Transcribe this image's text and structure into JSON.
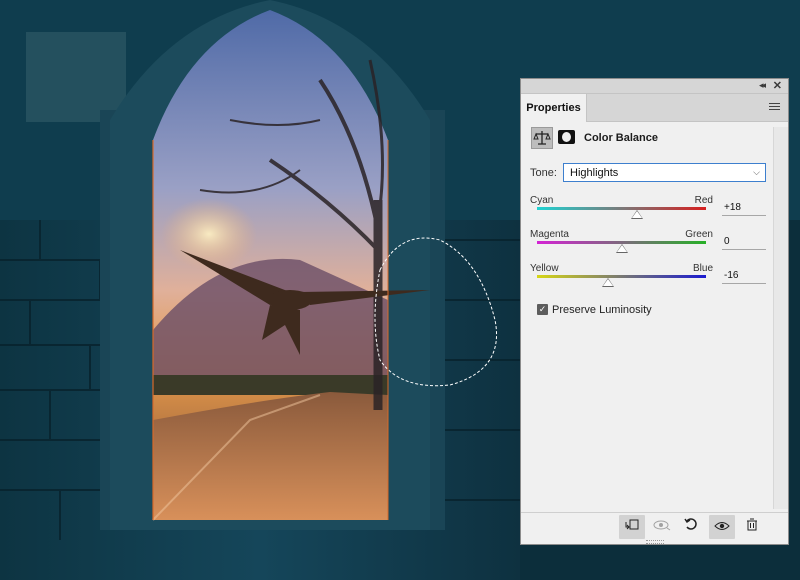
{
  "panel": {
    "tab_label": "Properties",
    "adjustment_title": "Color Balance",
    "tone_label": "Tone:",
    "tone_value": "Highlights",
    "sliders": [
      {
        "left": "Cyan",
        "right": "Red",
        "value": "+18",
        "level": 0.59,
        "gradient": [
          "#1fd3d3",
          "#d61f1f"
        ]
      },
      {
        "left": "Magenta",
        "right": "Green",
        "value": "0",
        "level": 0.5,
        "gradient": [
          "#d423d4",
          "#27b027"
        ]
      },
      {
        "left": "Yellow",
        "right": "Blue",
        "value": "-16",
        "level": 0.42,
        "gradient": [
          "#d6d616",
          "#1a1ad0"
        ]
      }
    ],
    "preserve_label": "Preserve Luminosity",
    "preserve_checked": true,
    "icons": {
      "collapse": "double-chevron-icon",
      "close": "close-icon",
      "menu": "panel-menu-icon",
      "adjustment": "color-balance-icon",
      "mask": "layer-mask-icon",
      "footer": [
        "clip-to-layer-icon",
        "view-previous-state-icon",
        "reset-icon",
        "visibility-eye-icon",
        "trash-icon"
      ]
    }
  },
  "colors": {
    "accent": "#3d7fce",
    "panel_bg": "#f0f0f0"
  }
}
